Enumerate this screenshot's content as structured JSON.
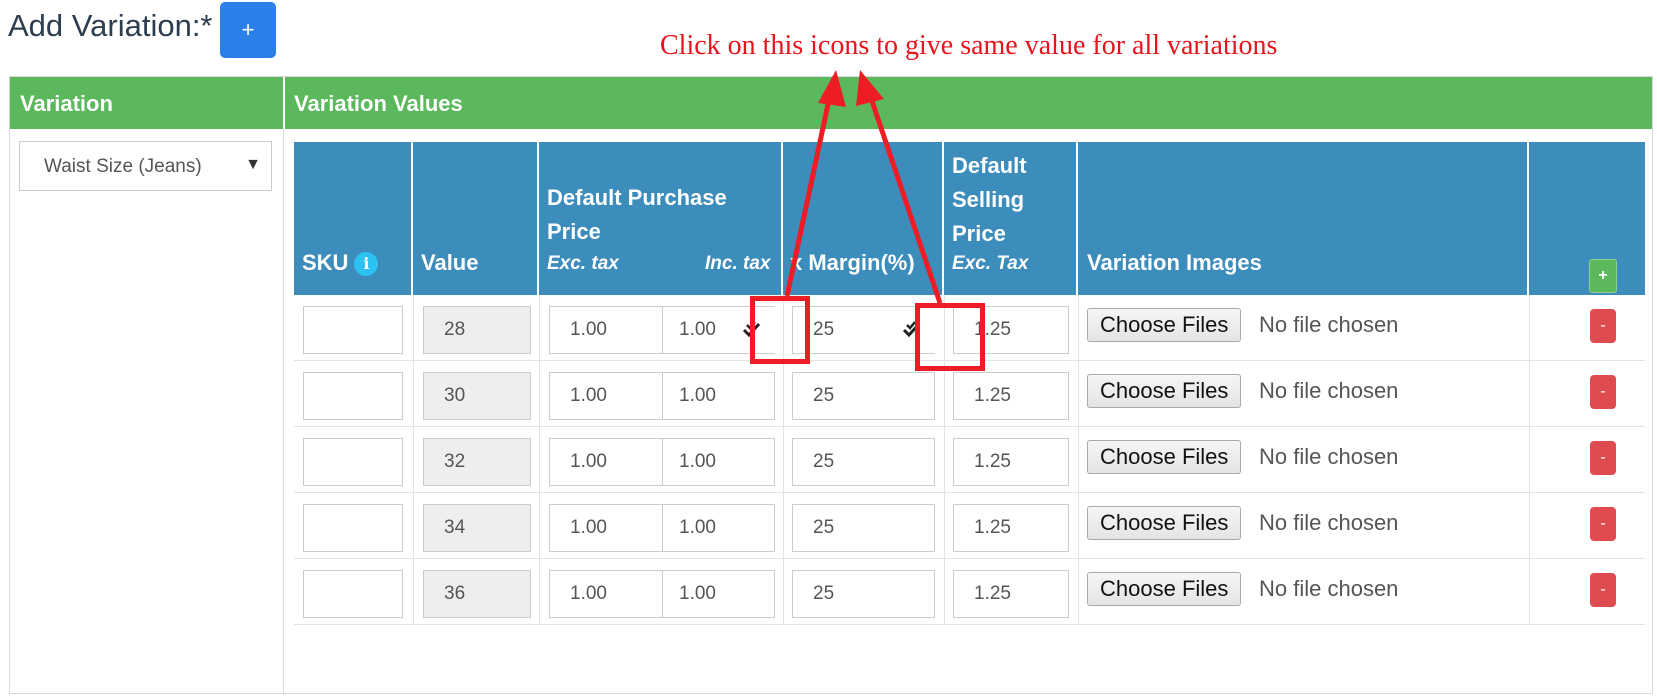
{
  "header": {
    "title": "Add Variation:*",
    "add_label": "+"
  },
  "annotation": {
    "text": "Click on this icons to give same value for all variations"
  },
  "table": {
    "col_variation": "Variation",
    "col_variation_values": "Variation Values",
    "variation_select": {
      "value": "Waist Size (Jeans)",
      "caret": "▼"
    },
    "headers": {
      "sku": "SKU",
      "sku_info": "i",
      "value": "Value",
      "dpp_line1": "Default Purchase",
      "dpp_line2": "Price",
      "exc_tax": "Exc. tax",
      "inc_tax": "Inc. tax",
      "margin": "x Margin(%)",
      "dsp_line1": "Default",
      "dsp_line2": "Selling",
      "dsp_line3": "Price",
      "dsp_exc": "Exc. Tax",
      "images": "Variation Images",
      "add_row": "+"
    },
    "rows": [
      {
        "sku": "",
        "value": "28",
        "exc": "1.00",
        "inc": "1.00",
        "margin": "25",
        "selling": "1.25",
        "file_button": "Choose Files",
        "file_status": "No file chosen",
        "remove": "-"
      },
      {
        "sku": "",
        "value": "30",
        "exc": "1.00",
        "inc": "1.00",
        "margin": "25",
        "selling": "1.25",
        "file_button": "Choose Files",
        "file_status": "No file chosen",
        "remove": "-"
      },
      {
        "sku": "",
        "value": "32",
        "exc": "1.00",
        "inc": "1.00",
        "margin": "25",
        "selling": "1.25",
        "file_button": "Choose Files",
        "file_status": "No file chosen",
        "remove": "-"
      },
      {
        "sku": "",
        "value": "34",
        "exc": "1.00",
        "inc": "1.00",
        "margin": "25",
        "selling": "1.25",
        "file_button": "Choose Files",
        "file_status": "No file chosen",
        "remove": "-"
      },
      {
        "sku": "",
        "value": "36",
        "exc": "1.00",
        "inc": "1.00",
        "margin": "25",
        "selling": "1.25",
        "file_button": "Choose Files",
        "file_status": "No file chosen",
        "remove": "-"
      }
    ]
  },
  "icons": {
    "apply_all": "double-check-icon",
    "info": "info-icon",
    "caret": "caret-down-icon"
  },
  "colors": {
    "green": "#5cb85c",
    "blue": "#3c8dbc",
    "primary": "#2a7fe8",
    "danger": "#e04b4f",
    "annotation": "#ee1c24"
  }
}
